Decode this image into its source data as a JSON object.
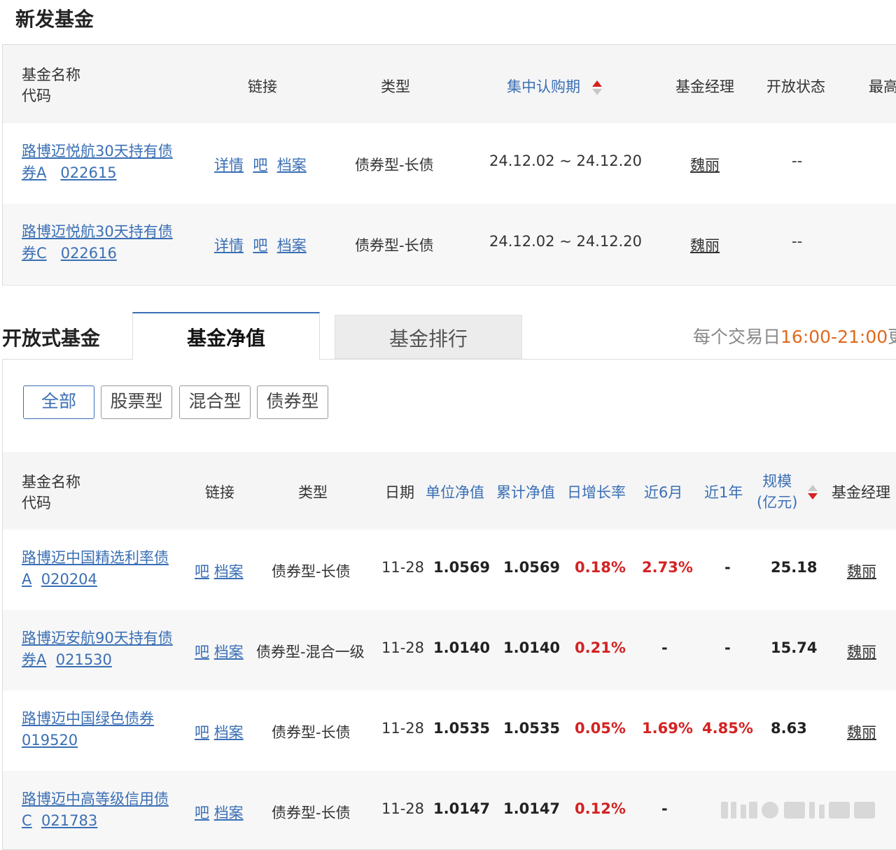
{
  "new_funds": {
    "title": "新发基金",
    "headers": {
      "name": "基金名称",
      "code": "代码",
      "links": "链接",
      "type": "类型",
      "period": "集中认购期",
      "manager": "基金经理",
      "status": "开放状态",
      "highest": "最高"
    },
    "rows": [
      {
        "name_l1": "路博迈悦航30天持有债",
        "name_l2": "券A",
        "code": "022615",
        "link1": "详情",
        "link2": "吧",
        "link3": "档案",
        "type": "债券型-长债",
        "period": "24.12.02 ~ 24.12.20",
        "manager": "魏丽",
        "status": "--"
      },
      {
        "name_l1": "路博迈悦航30天持有债",
        "name_l2": "券C",
        "code": "022616",
        "link1": "详情",
        "link2": "吧",
        "link3": "档案",
        "type": "债券型-长债",
        "period": "24.12.02 ~ 24.12.20",
        "manager": "魏丽",
        "status": "--"
      }
    ]
  },
  "open_funds": {
    "title": "开放式基金",
    "tabs": [
      "基金净值",
      "基金排行"
    ],
    "notice_prefix": "每个交易日",
    "notice_time": "16:00-21:00",
    "notice_suffix": "更",
    "filters": [
      "全部",
      "股票型",
      "混合型",
      "债券型"
    ],
    "headers": {
      "name": "基金名称",
      "code": "代码",
      "links": "链接",
      "type": "类型",
      "date": "日期",
      "nav": "单位净值",
      "acc_nav": "累计净值",
      "daily": "日增长率",
      "m6": "近6月",
      "y1": "近1年",
      "scale_l1": "规模",
      "scale_l2": "(亿元)",
      "manager": "基金经理"
    },
    "rows": [
      {
        "name_l1": "路博迈中国精选利率债",
        "name_l2": "A",
        "code": "020204",
        "link1": "吧",
        "link2": "档案",
        "type": "债券型-长债",
        "date": "11-28",
        "nav": "1.0569",
        "acc_nav": "1.0569",
        "daily": "0.18%",
        "m6": "2.73%",
        "y1": "-",
        "scale": "25.18",
        "manager": "魏丽"
      },
      {
        "name_l1": "路博迈安航90天持有债",
        "name_l2": "券A",
        "code": "021530",
        "link1": "吧",
        "link2": "档案",
        "type": "债券型-混合一级",
        "date": "11-28",
        "nav": "1.0140",
        "acc_nav": "1.0140",
        "daily": "0.21%",
        "m6": "-",
        "y1": "-",
        "scale": "15.74",
        "manager": "魏丽"
      },
      {
        "name_l1": "路博迈中国绿色债券",
        "name_l2": "",
        "code": "019520",
        "link1": "吧",
        "link2": "档案",
        "type": "债券型-长债",
        "date": "11-28",
        "nav": "1.0535",
        "acc_nav": "1.0535",
        "daily": "0.05%",
        "m6": "1.69%",
        "y1": "4.85%",
        "scale": "8.63",
        "manager": "魏丽"
      },
      {
        "name_l1": "路博迈中高等级信用债",
        "name_l2": "C",
        "code": "021783",
        "link1": "吧",
        "link2": "档案",
        "type": "债券型-长债",
        "date": "11-28",
        "nav": "1.0147",
        "acc_nav": "1.0147",
        "daily": "0.12%",
        "m6": "-",
        "y1": "",
        "scale": "",
        "manager": ""
      }
    ]
  },
  "colors": {
    "link": "#3a6fb5",
    "positive": "#d42222",
    "notice_time": "#e06a1b"
  }
}
